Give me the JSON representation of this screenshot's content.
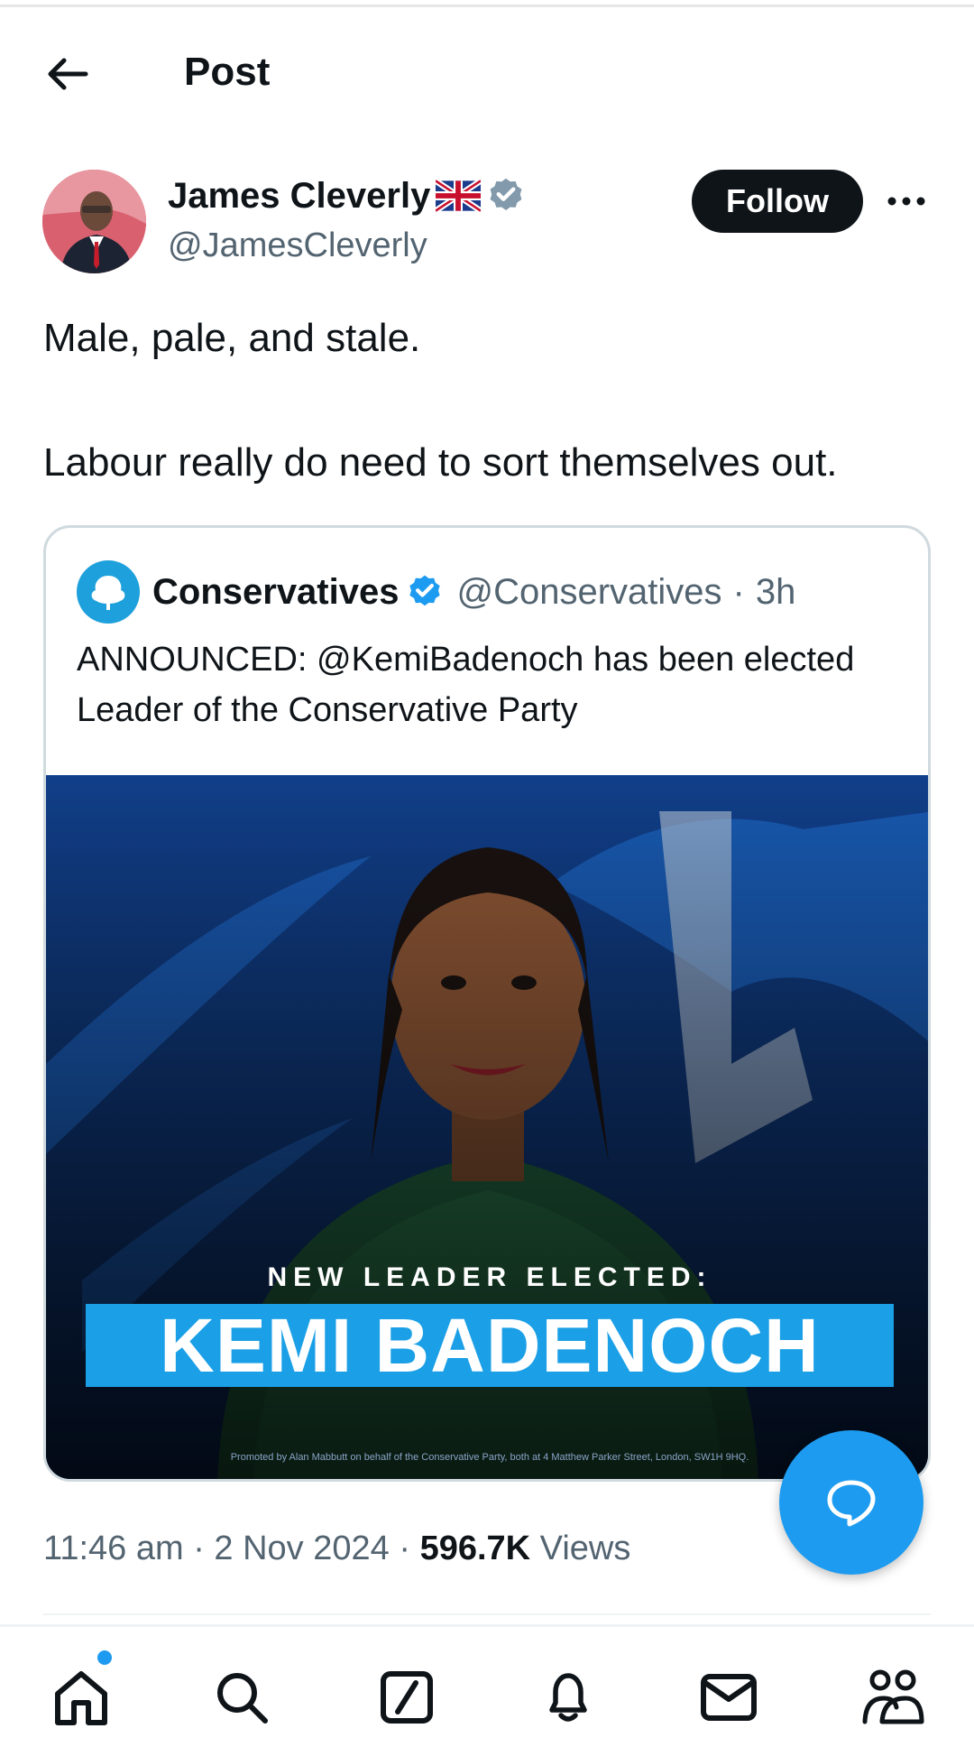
{
  "header": {
    "title": "Post"
  },
  "author": {
    "name": "James Cleverly",
    "handle": "@JamesCleverly",
    "follow_label": "Follow"
  },
  "post": {
    "line1": "Male, pale, and stale.",
    "line2": "Labour really do need to sort themselves out."
  },
  "quote": {
    "name": "Conservatives",
    "handle": "@Conservatives",
    "separator": "·",
    "time": "3h",
    "text": "ANNOUNCED: @KemiBadenoch has been elected Leader of the Conservative Party",
    "image": {
      "label_small": "NEW LEADER ELECTED:",
      "banner": "KEMI BADENOCH",
      "footnote": "Promoted by Alan Mabbutt on behalf of the Conservative Party, both at 4 Matthew Parker Street, London, SW1H 9HQ."
    }
  },
  "meta": {
    "time": "11:46 am",
    "sep1": "·",
    "date": "2 Nov 2024",
    "sep2": "·",
    "views_count": "596.7K",
    "views_label": "Views"
  },
  "colors": {
    "accent": "#1d9bf0",
    "text": "#0f1419",
    "secondary": "#536471",
    "image_bg": "#0f3e86",
    "banner": "#1b9fe6"
  },
  "nav": {
    "items": [
      "home-icon",
      "search-icon",
      "compose-icon",
      "bell-icon",
      "mail-icon",
      "communities-icon"
    ]
  }
}
